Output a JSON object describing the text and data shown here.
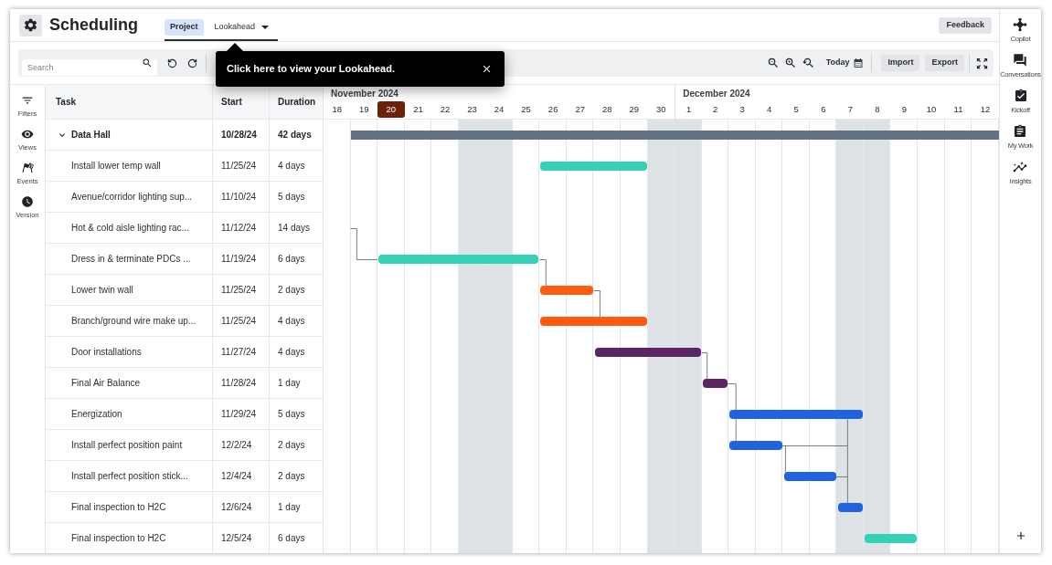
{
  "header": {
    "title": "Scheduling",
    "tabs": [
      {
        "label": "Project",
        "selected": true,
        "dropdown": false
      },
      {
        "label": "Lookahead",
        "selected": false,
        "dropdown": true
      }
    ],
    "feedback": "Feedback"
  },
  "toolbar": {
    "search": {
      "placeholder": "Search"
    },
    "today": "Today",
    "buttons": [
      "Import",
      "Export"
    ]
  },
  "tooltip": {
    "text": "Click here to view your Lookahead."
  },
  "left_sidebar": {
    "items": [
      {
        "label": "Filters"
      },
      {
        "label": "Views"
      },
      {
        "label": "Events"
      },
      {
        "label": "Version"
      }
    ]
  },
  "right_sidebar": {
    "items": [
      {
        "label": "Copilot"
      },
      {
        "label": "Conversations"
      },
      {
        "label": "Kickoff"
      },
      {
        "label": "My Work"
      },
      {
        "label": "Insights"
      }
    ]
  },
  "table": {
    "columns": [
      "Task",
      "Start",
      "Duration"
    ],
    "rows": [
      {
        "kind": "group",
        "task": "Data Hall",
        "start": "10/28/24",
        "duration": "42 days",
        "expanded": true,
        "bar": {
          "color": "#637282"
        }
      },
      {
        "kind": "task",
        "task": "Install lower temp wall",
        "start": "11/25/24",
        "duration": "4 days",
        "bar": {
          "color": "#33d1b6"
        }
      },
      {
        "kind": "task",
        "task": "Avenue/corridor lighting sup...",
        "start": "11/10/24",
        "duration": "5 days"
      },
      {
        "kind": "task",
        "task": "Hot & cold aisle lighting rac...",
        "start": "11/12/24",
        "duration": "14 days"
      },
      {
        "kind": "task",
        "task": "Dress in & terminate PDCs ...",
        "start": "11/19/24",
        "duration": "6 days",
        "bar": {
          "color": "#33d1b6"
        }
      },
      {
        "kind": "task",
        "task": "Lower twin wall",
        "start": "11/25/24",
        "duration": "2 days",
        "bar": {
          "color": "#ff5a0f"
        }
      },
      {
        "kind": "task",
        "task": "Branch/ground wire make up...",
        "start": "11/25/24",
        "duration": "4 days",
        "bar": {
          "color": "#ff5a0f"
        }
      },
      {
        "kind": "task",
        "task": "Door installations",
        "start": "11/27/24",
        "duration": "4 days",
        "bar": {
          "color": "#5b2466"
        }
      },
      {
        "kind": "task",
        "task": "Final Air Balance",
        "start": "11/28/24",
        "duration": "1 day",
        "bar": {
          "color": "#5b2466"
        }
      },
      {
        "kind": "task",
        "task": "Energization",
        "start": "11/29/24",
        "duration": "5 days",
        "bar": {
          "color": "#1f64de"
        }
      },
      {
        "kind": "task",
        "task": "Install perfect position paint",
        "start": "12/2/24",
        "duration": "2 days",
        "bar": {
          "color": "#1f64de"
        }
      },
      {
        "kind": "task",
        "task": "Install perfect position stick...",
        "start": "12/4/24",
        "duration": "2 days",
        "bar": {
          "color": "#1f64de"
        }
      },
      {
        "kind": "task",
        "task": "Final inspection to H2C",
        "start": "12/6/24",
        "duration": "1 day",
        "bar": {
          "color": "#1f64de"
        }
      },
      {
        "kind": "task",
        "task": "Final inspection to H2C",
        "start": "12/5/24",
        "duration": "6 days",
        "bar": {
          "color": "#33d1b6"
        }
      }
    ]
  },
  "timeline": {
    "months": [
      {
        "label": "November 2024",
        "days": [
          {
            "label": "18",
            "today": false,
            "weekend": false
          },
          {
            "label": "19",
            "today": false,
            "weekend": false
          },
          {
            "label": "20",
            "today": true,
            "weekend": false
          },
          {
            "label": "21",
            "today": false,
            "weekend": false
          },
          {
            "label": "22",
            "today": false,
            "weekend": false
          },
          {
            "label": "23",
            "today": false,
            "weekend": true
          },
          {
            "label": "24",
            "today": false,
            "weekend": true
          },
          {
            "label": "25",
            "today": false,
            "weekend": false
          },
          {
            "label": "26",
            "today": false,
            "weekend": false
          },
          {
            "label": "27",
            "today": false,
            "weekend": false
          },
          {
            "label": "28",
            "today": false,
            "weekend": false
          },
          {
            "label": "29",
            "today": false,
            "weekend": false
          },
          {
            "label": "30",
            "today": false,
            "weekend": true
          }
        ]
      },
      {
        "label": "December 2024",
        "days": [
          {
            "label": "1",
            "today": false,
            "weekend": true
          },
          {
            "label": "2",
            "today": false,
            "weekend": false
          },
          {
            "label": "3",
            "today": false,
            "weekend": false
          },
          {
            "label": "4",
            "today": false,
            "weekend": false
          },
          {
            "label": "5",
            "today": false,
            "weekend": false
          },
          {
            "label": "6",
            "today": false,
            "weekend": false
          },
          {
            "label": "7",
            "today": false,
            "weekend": true
          },
          {
            "label": "8",
            "today": false,
            "weekend": true
          },
          {
            "label": "9",
            "today": false,
            "weekend": false
          },
          {
            "label": "10",
            "today": false,
            "weekend": false
          },
          {
            "label": "11",
            "today": false,
            "weekend": false
          },
          {
            "label": "12",
            "today": false,
            "weekend": false
          }
        ]
      }
    ]
  }
}
